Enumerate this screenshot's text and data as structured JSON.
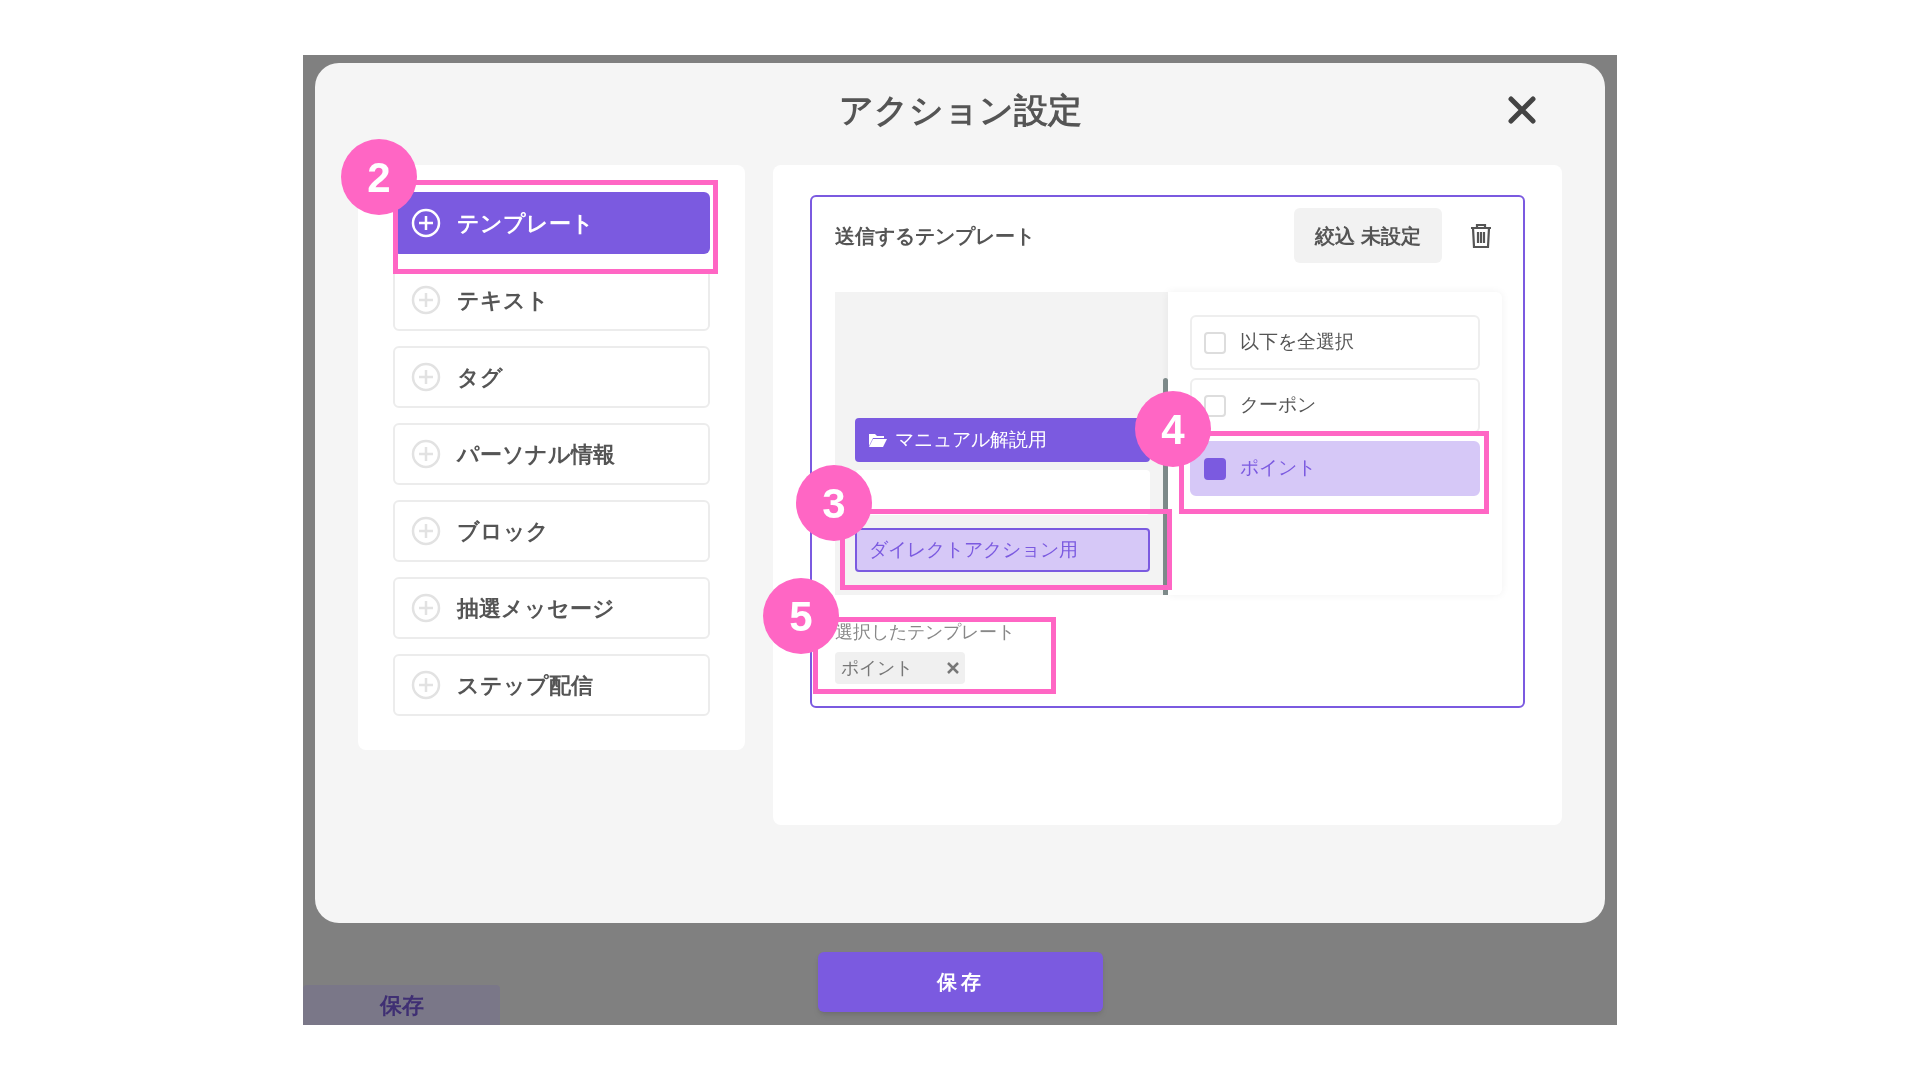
{
  "background_save_button": "保存",
  "modal": {
    "title": "アクション設定"
  },
  "menu": [
    {
      "label": "テンプレート",
      "selected": true
    },
    {
      "label": "テキスト",
      "selected": false
    },
    {
      "label": "タグ",
      "selected": false
    },
    {
      "label": "パーソナル情報",
      "selected": false
    },
    {
      "label": "ブロック",
      "selected": false
    },
    {
      "label": "抽選メッセージ",
      "selected": false
    },
    {
      "label": "ステップ配信",
      "selected": false
    }
  ],
  "template_section": {
    "title": "送信するテンプレート",
    "filter_button": "絞込 未設定"
  },
  "folders": [
    {
      "kind": "folder",
      "label": "マニュアル解説用",
      "selected": true
    },
    {
      "kind": "blank",
      "selected": false
    },
    {
      "kind": "category",
      "label": "ダイレクトアクション用",
      "selected": true
    }
  ],
  "templates": [
    {
      "label": "以下を全選択",
      "checked": false
    },
    {
      "label": "クーポン",
      "checked": false
    },
    {
      "label": "ポイント",
      "checked": true
    }
  ],
  "selected_templates": {
    "label": "選択したテンプレート",
    "chips": [
      "ポイント"
    ]
  },
  "save_button": "保存",
  "annotations": [
    {
      "number": "2"
    },
    {
      "number": "3"
    },
    {
      "number": "4"
    },
    {
      "number": "5"
    }
  ]
}
